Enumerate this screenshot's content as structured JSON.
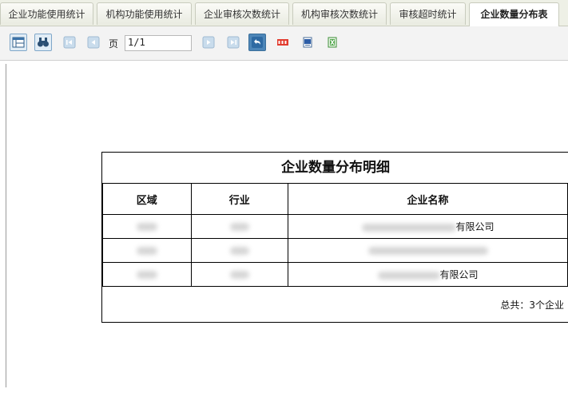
{
  "tabs": [
    {
      "label": "企业功能使用统计",
      "active": false
    },
    {
      "label": "机构功能使用统计",
      "active": false
    },
    {
      "label": "企业审核次数统计",
      "active": false
    },
    {
      "label": "机构审核次数统计",
      "active": false
    },
    {
      "label": "审核超时统计",
      "active": false
    },
    {
      "label": "企业数量分布表",
      "active": true
    }
  ],
  "toolbar": {
    "page_label": "页",
    "page_value": "1/1",
    "icons": [
      "table-view-icon",
      "binoculars-icon",
      "first-page-icon",
      "previous-page-icon",
      "next-page-icon",
      "last-page-icon",
      "back-icon",
      "pdf-export-icon",
      "word-export-icon",
      "excel-export-icon"
    ]
  },
  "report": {
    "title": "企业数量分布明细",
    "columns": [
      "区域",
      "行业",
      "企业名称"
    ],
    "rows": [
      {
        "region": "",
        "industry": "",
        "company": "有限公司"
      },
      {
        "region": "",
        "industry": "",
        "company": ""
      },
      {
        "region": "",
        "industry": "",
        "company": "有限公司"
      }
    ],
    "total": "总共：3个企业"
  },
  "colors": {
    "accent": "#4d86b8",
    "tab_bar": "#eef0e6"
  }
}
